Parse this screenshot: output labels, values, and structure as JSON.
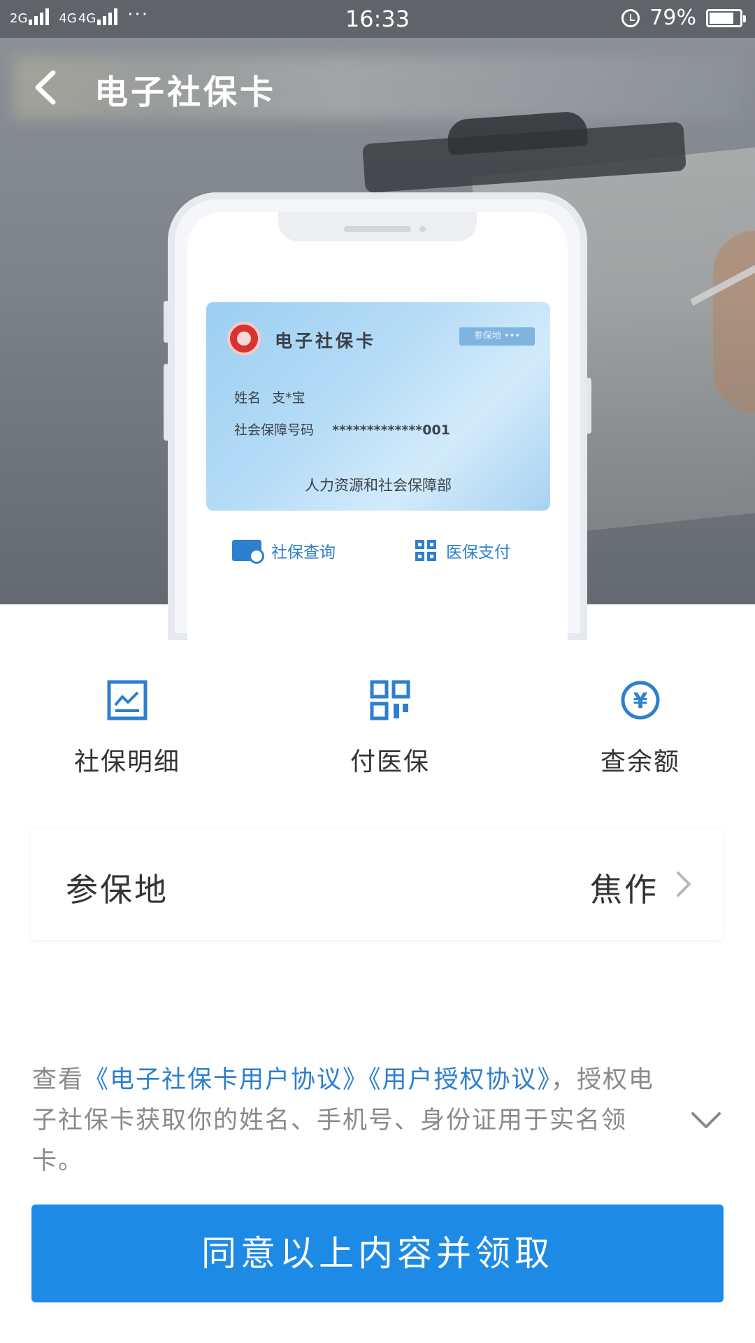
{
  "status_bar": {
    "sim1": "2G",
    "sim2": "4G",
    "sim2b": "4G",
    "dots": "···",
    "time": "16:33",
    "battery_text": "79%",
    "battery_level": 0.79
  },
  "nav": {
    "title": "电子社保卡"
  },
  "card": {
    "title": "电子社保卡",
    "tag": "参保地 •••",
    "name_label": "姓名",
    "name_value": "支*宝",
    "number_label": "社会保障号码",
    "number_value": "*************001",
    "issuer": "人力资源和社会保障部"
  },
  "phone_actions": {
    "query": "社保查询",
    "pay": "医保支付"
  },
  "features": [
    {
      "label": "社保明细",
      "icon": "chart-icon"
    },
    {
      "label": "付医保",
      "icon": "qr-code-icon"
    },
    {
      "label": "查余额",
      "icon": "yuan-icon"
    }
  ],
  "insured_place": {
    "label": "参保地",
    "value": "焦作"
  },
  "agreement": {
    "prefix": "查看",
    "link1": "《电子社保卡用户协议》",
    "link2": "《用户授权协议》",
    "suffix": "，授权电子社保卡获取你的姓名、手机号、身份证用于实名领卡。"
  },
  "button": {
    "label": "同意以上内容并领取"
  },
  "colors": {
    "accent": "#1d8ae6",
    "link": "#2d7fcf"
  }
}
